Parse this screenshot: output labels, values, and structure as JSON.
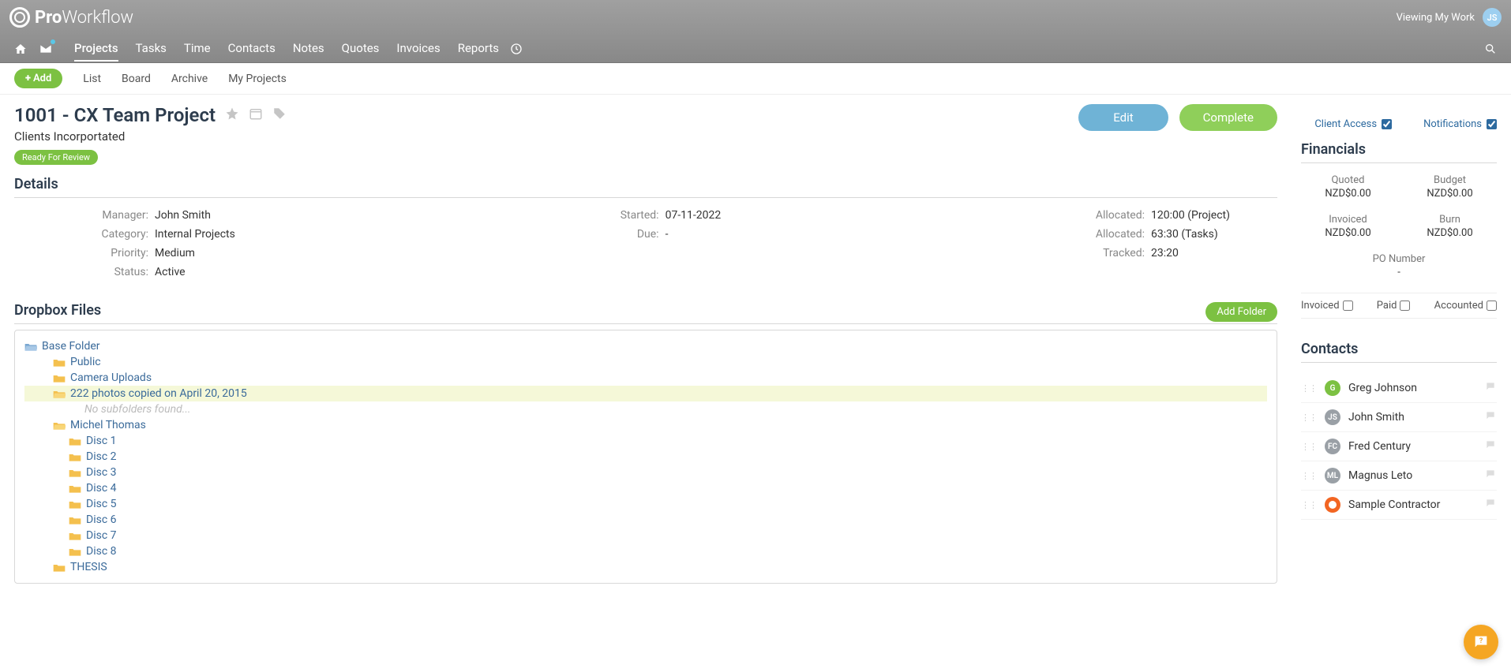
{
  "header": {
    "logo_bold": "Pro",
    "logo_light": "Workflow",
    "viewing_text": "Viewing My Work",
    "viewing_avatar": "JS"
  },
  "nav": {
    "items": [
      "Projects",
      "Tasks",
      "Time",
      "Contacts",
      "Notes",
      "Quotes",
      "Invoices",
      "Reports"
    ],
    "active_index": 0
  },
  "subnav": {
    "add_label": "Add",
    "items": [
      "List",
      "Board",
      "Archive",
      "My Projects"
    ]
  },
  "project": {
    "title": "1001 - CX Team Project",
    "client": "Clients Incorportated",
    "status_badge": "Ready For Review",
    "edit_label": "Edit",
    "complete_label": "Complete",
    "client_access_label": "Client Access",
    "notifications_label": "Notifications"
  },
  "details": {
    "heading": "Details",
    "col1": [
      {
        "label": "Manager:",
        "value": "John Smith"
      },
      {
        "label": "Category:",
        "value": "Internal Projects"
      },
      {
        "label": "Priority:",
        "value": "Medium"
      },
      {
        "label": "Status:",
        "value": "Active"
      }
    ],
    "col2": [
      {
        "label": "Started:",
        "value": "07-11-2022"
      },
      {
        "label": "Due:",
        "value": "-"
      }
    ],
    "col3": [
      {
        "label": "Allocated:",
        "value": "120:00 (Project)"
      },
      {
        "label": "Allocated:",
        "value": "63:30 (Tasks)"
      },
      {
        "label": "Tracked:",
        "value": "23:20"
      }
    ]
  },
  "dropbox": {
    "heading": "Dropbox Files",
    "add_folder_label": "Add Folder",
    "tree": [
      {
        "indent": 0,
        "name": "Base Folder",
        "open": true
      },
      {
        "indent": 1,
        "name": "Public"
      },
      {
        "indent": 1,
        "name": "Camera Uploads"
      },
      {
        "indent": 1,
        "name": "222 photos copied on April 20, 2015",
        "selected": true,
        "open": true
      },
      {
        "indent": 3,
        "name": "No subfolders found...",
        "nosub": true
      },
      {
        "indent": 1,
        "name": "Michel Thomas",
        "open": true
      },
      {
        "indent": 2,
        "name": "Disc 1"
      },
      {
        "indent": 2,
        "name": "Disc 2"
      },
      {
        "indent": 2,
        "name": "Disc 3"
      },
      {
        "indent": 2,
        "name": "Disc 4"
      },
      {
        "indent": 2,
        "name": "Disc 5"
      },
      {
        "indent": 2,
        "name": "Disc 6"
      },
      {
        "indent": 2,
        "name": "Disc 7"
      },
      {
        "indent": 2,
        "name": "Disc 8"
      },
      {
        "indent": 1,
        "name": "THESIS"
      }
    ]
  },
  "financials": {
    "heading": "Financials",
    "items": [
      {
        "label": "Quoted",
        "value": "NZD$0.00"
      },
      {
        "label": "Budget",
        "value": "NZD$0.00"
      },
      {
        "label": "Invoiced",
        "value": "NZD$0.00"
      },
      {
        "label": "Burn",
        "value": "NZD$0.00"
      }
    ],
    "po_label": "PO Number",
    "po_value": "-",
    "checks": [
      "Invoiced",
      "Paid",
      "Accounted"
    ]
  },
  "contacts": {
    "heading": "Contacts",
    "items": [
      {
        "initials": "G",
        "name": "Greg Johnson",
        "color": "#7cc142"
      },
      {
        "initials": "JS",
        "name": "John Smith",
        "color": "#9aa0a6"
      },
      {
        "initials": "FC",
        "name": "Fred Century",
        "color": "#9aa0a6"
      },
      {
        "initials": "ML",
        "name": "Magnus Leto",
        "color": "#9aa0a6"
      },
      {
        "initials": "",
        "name": "Sample Contractor",
        "color": "#f26522",
        "icon": true
      }
    ]
  }
}
